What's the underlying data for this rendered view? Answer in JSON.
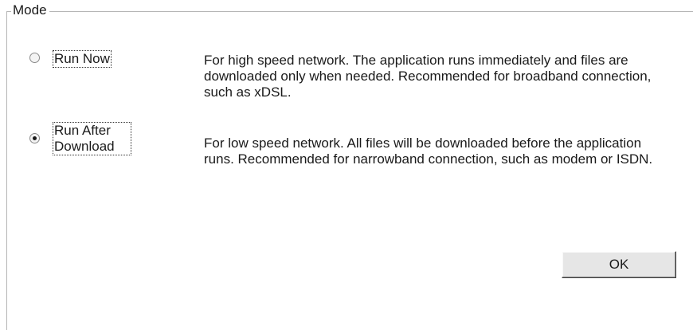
{
  "mode_group": {
    "title": "Mode"
  },
  "options": [
    {
      "label": "Run Now",
      "selected": false,
      "description": "For high speed network. The application runs immediately and files are downloaded only when needed. Recommended for broadband connection, such as xDSL."
    },
    {
      "label_line1": "Run After",
      "label_line2": "Download",
      "selected": true,
      "description": "For low speed network. All files will be downloaded before the application runs. Recommended for narrowband connection, such as modem or ISDN."
    }
  ],
  "buttons": {
    "ok_label": "OK"
  }
}
